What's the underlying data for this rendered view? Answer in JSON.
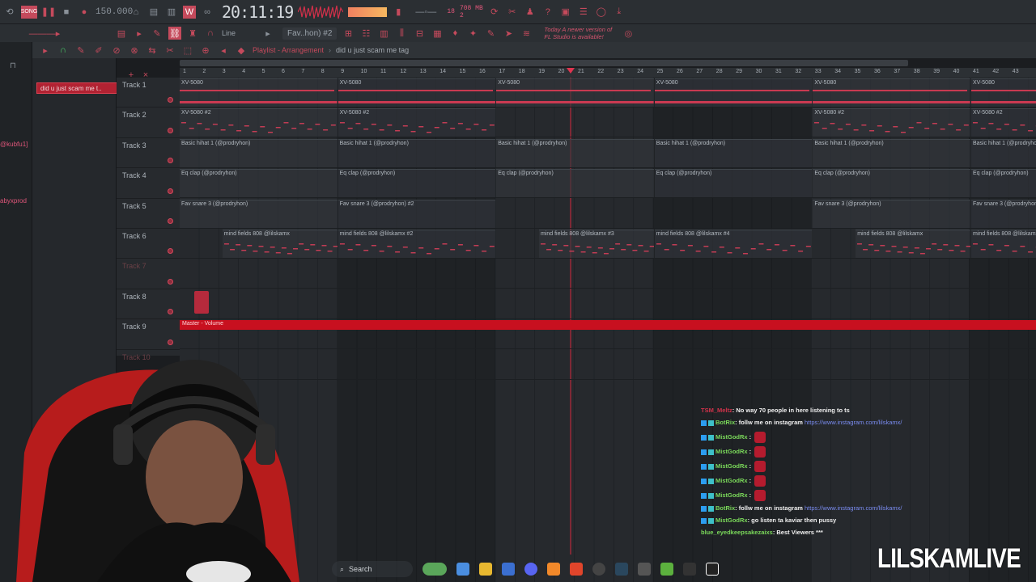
{
  "toolbar": {
    "tempo": "150.000",
    "time": "20:11:19",
    "cpu": "18",
    "ram": "708 MB",
    "ram2": "2"
  },
  "toolbar2": {
    "pattern": "Fav..hon) #2",
    "snap": "Line",
    "news": "Today  A newer version of FL Studio is available!"
  },
  "browser": {
    "users": [
      "@kubfu1]",
      "abyxprod"
    ]
  },
  "playlist": {
    "title": "Playlist - Arrangement",
    "separator": "›",
    "arrangement": "did u just scam me tag",
    "picker_item": "did u just scam me t.."
  },
  "ruler": [
    "1",
    "2",
    "3",
    "4",
    "5",
    "6",
    "7",
    "8",
    "9",
    "10",
    "11",
    "12",
    "13",
    "14",
    "15",
    "16",
    "17",
    "18",
    "19",
    "20",
    "21",
    "22",
    "23",
    "24",
    "25",
    "26",
    "27",
    "28",
    "29",
    "30",
    "31",
    "32",
    "33",
    "34",
    "35",
    "36",
    "37",
    "38",
    "39",
    "40",
    "41",
    "42",
    "43"
  ],
  "tracks": [
    {
      "name": "Track 1"
    },
    {
      "name": "Track 2"
    },
    {
      "name": "Track 3"
    },
    {
      "name": "Track 4"
    },
    {
      "name": "Track 5"
    },
    {
      "name": "Track 6"
    },
    {
      "name": "Track 7"
    },
    {
      "name": "Track 8"
    },
    {
      "name": "Track 9"
    },
    {
      "name": "Track 10"
    }
  ],
  "clips": {
    "track1": [
      "XV-5080",
      "XV-5080",
      "XV-5080",
      "XV-5080",
      "XV-5080",
      "XV-5080"
    ],
    "track2": [
      "XV-5080 #2",
      "XV-5080 #2",
      "XV-5080 #2",
      "XV-5080 #2"
    ],
    "track3": [
      "Basic hihat 1 (@prodryhon)",
      "Basic hihat 1 (@prodryhon)",
      "Basic hihat 1 (@prodryhon)",
      "Basic hihat 1 (@prodryhon)",
      "Basic hihat 1 (@prodryhon)",
      "Basic hihat 1 (@prodryhon)"
    ],
    "track4": [
      "Eq clap (@prodryhon)",
      "Eq clap (@prodryhon)",
      "Eq clap (@prodryhon)",
      "Eq clap (@prodryhon)",
      "Eq clap (@prodryhon)",
      "Eq clap (@prodryhon)"
    ],
    "track5": [
      "Fav snare 3 (@prodryhon)",
      "Fav snare 3 (@prodryhon) #2",
      "Fav snare 3 (@prodryhon)",
      "Fav snare 3 (@prodryhon"
    ],
    "track6": [
      "mind fields 808 @lilskamx",
      "mind fields 808 @lilskamx #2",
      "mind fields 808 @lilskamx #3",
      "mind fields 808 @lilskamx #4",
      "mind fields 808 @lilskamx",
      "mind fields 808 @lilskamx"
    ],
    "track9": "Master - Volume"
  },
  "chat": [
    {
      "user": "TSM_Meltz",
      "text": ": No way 70 people in here listening to ts",
      "user_color": "#d0324a"
    },
    {
      "user": "BotRix",
      "text": ": follw me on instagram ",
      "link": "https://www.instagram.com/lilskamx/",
      "user_color": "#7ad85a"
    },
    {
      "user": "MistGodRx",
      "text": " :",
      "emote": true,
      "user_color": "#7ad85a"
    },
    {
      "user": "MistGodRx",
      "text": " :",
      "emote": true,
      "user_color": "#7ad85a"
    },
    {
      "user": "MistGodRx",
      "text": " :",
      "emote": true,
      "user_color": "#7ad85a"
    },
    {
      "user": "MistGodRx",
      "text": " :",
      "emote": true,
      "user_color": "#7ad85a"
    },
    {
      "user": "MistGodRx",
      "text": " :",
      "emote": true,
      "user_color": "#7ad85a"
    },
    {
      "user": "BotRix",
      "text": ": follw me on instagram ",
      "link": "https://www.instagram.com/lilskamx/",
      "user_color": "#7ad85a"
    },
    {
      "user": "MistGodRx",
      "text": ": go listen ta kaviar then pussy",
      "user_color": "#7ad85a"
    },
    {
      "user": "blue_eyedkeepsakezaixs",
      "text": ": Best Viewers ***",
      "user_color": "#7ad85a"
    }
  ],
  "taskbar": {
    "search": "Search"
  },
  "watermark": "LILSKAMLIVE",
  "colors": {
    "accent": "#c54a5c",
    "master": "#c8101f",
    "bg": "#26292d"
  }
}
